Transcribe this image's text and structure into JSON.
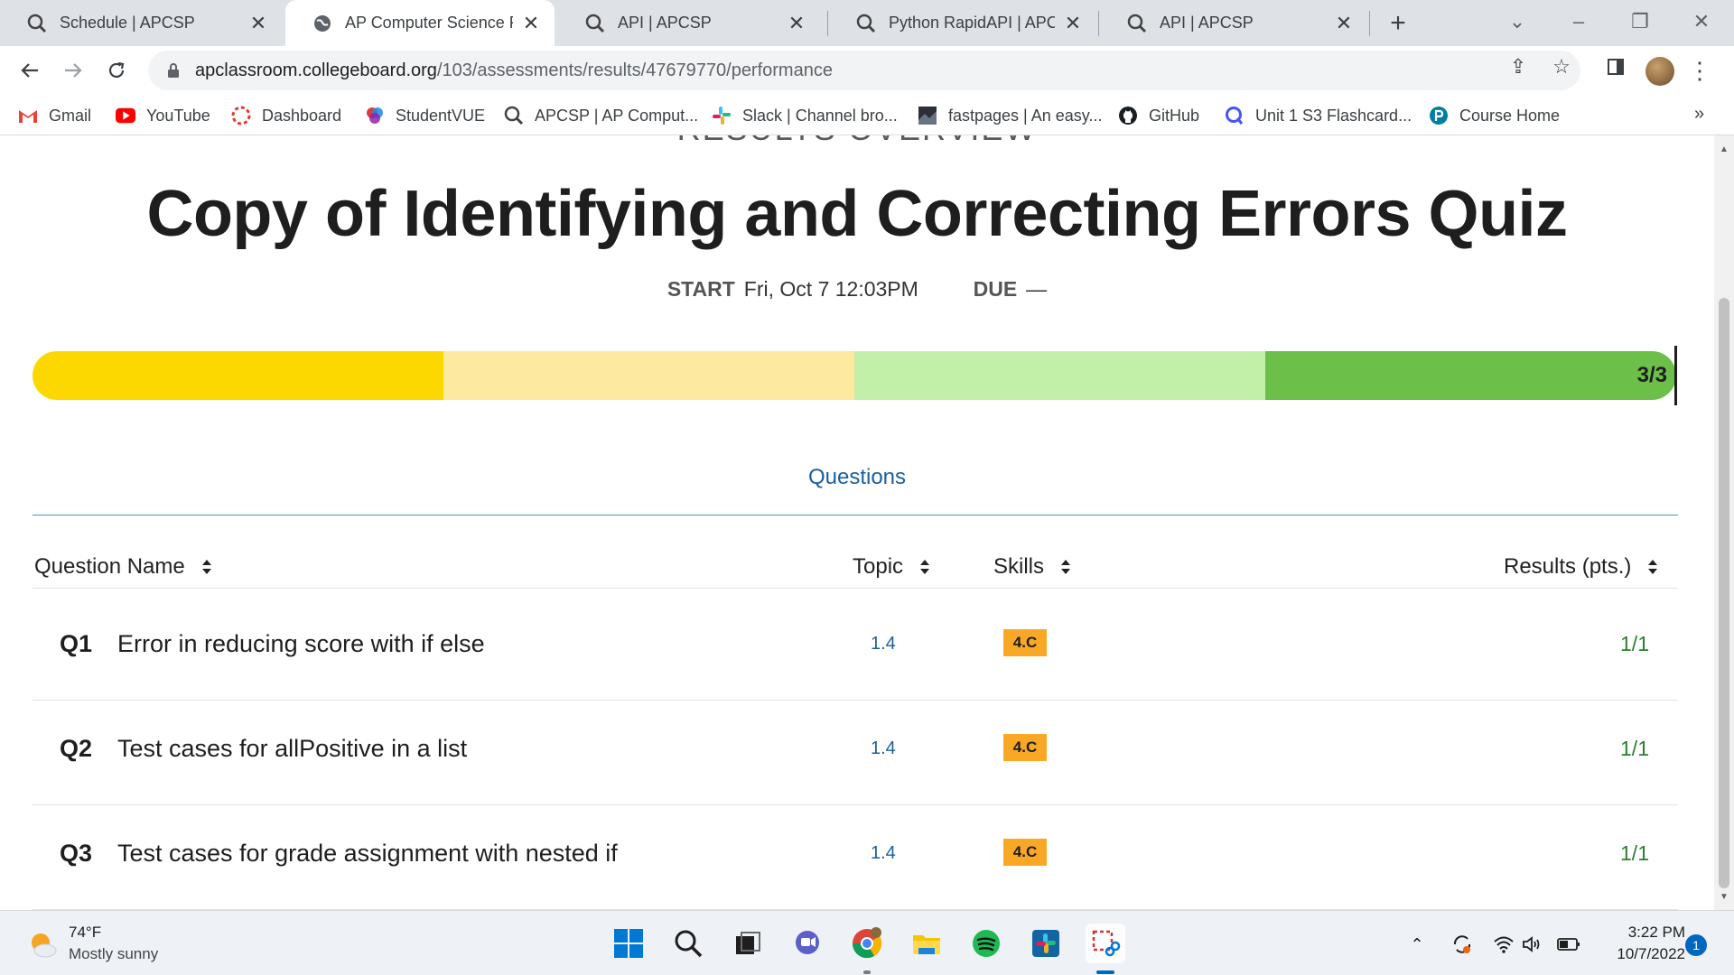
{
  "browser": {
    "tabs": [
      {
        "title": "Schedule | APCSP",
        "icon": "apcsp-icon",
        "active": false
      },
      {
        "title": "AP Computer Science Prin",
        "icon": "globe-icon",
        "active": true
      },
      {
        "title": "API | APCSP",
        "icon": "apcsp-icon",
        "active": false
      },
      {
        "title": "Python RapidAPI | APCSP",
        "icon": "apcsp-icon",
        "active": false
      },
      {
        "title": "API | APCSP",
        "icon": "apcsp-icon",
        "active": false
      }
    ],
    "url_host": "apclassroom.collegeboard.org",
    "url_path": "/103/assessments/results/47679770/performance",
    "bookmarks": [
      {
        "label": "Gmail",
        "icon": "gmail-icon"
      },
      {
        "label": "YouTube",
        "icon": "youtube-icon"
      },
      {
        "label": "Dashboard",
        "icon": "dashboard-icon"
      },
      {
        "label": "StudentVUE",
        "icon": "studentvue-icon"
      },
      {
        "label": "APCSP | AP Comput...",
        "icon": "apcsp-icon"
      },
      {
        "label": "Slack | Channel bro...",
        "icon": "slack-icon"
      },
      {
        "label": "fastpages | An easy...",
        "icon": "fastpages-icon"
      },
      {
        "label": "GitHub",
        "icon": "github-icon"
      },
      {
        "label": "Unit 1 S3 Flashcard...",
        "icon": "quizlet-icon"
      },
      {
        "label": "Course Home",
        "icon": "pearson-icon"
      }
    ]
  },
  "page": {
    "overview_label": "RESULTS OVERVIEW",
    "title": "Copy of Identifying and Correcting Errors Quiz",
    "start_label": "START",
    "start_value": "Fri, Oct 7 12:03PM",
    "due_label": "DUE",
    "due_value": "—",
    "progress": {
      "label": "3/3",
      "score": 3,
      "total": 3,
      "segment_colors": [
        "#fdd800",
        "#fde9a0",
        "#c2f0a8",
        "#6cc04a"
      ]
    },
    "section_tab": "Questions",
    "table": {
      "headers": {
        "name": "Question Name",
        "topic": "Topic",
        "skills": "Skills",
        "results": "Results (pts.)"
      },
      "rows": [
        {
          "num": "Q1",
          "name": "Error in reducing score with if else",
          "topic": "1.4",
          "skill": "4.C",
          "result": "1/1"
        },
        {
          "num": "Q2",
          "name": "Test cases for allPositive in a list",
          "topic": "1.4",
          "skill": "4.C",
          "result": "1/1"
        },
        {
          "num": "Q3",
          "name": "Test cases for grade assignment with nested if",
          "topic": "1.4",
          "skill": "4.C",
          "result": "1/1"
        }
      ]
    }
  },
  "taskbar": {
    "weather_temp": "74°F",
    "weather_desc": "Mostly sunny",
    "time": "3:22 PM",
    "date": "10/7/2022",
    "notifications": "1"
  },
  "colors": {
    "link_blue": "#1a5f9e",
    "skill_badge": "#f9a825",
    "result_green": "#2e7d32"
  }
}
